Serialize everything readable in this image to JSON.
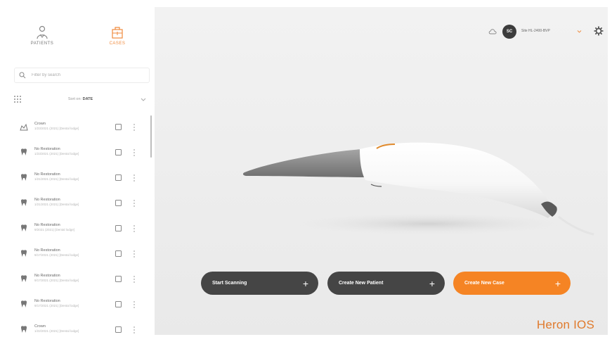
{
  "sidebar": {
    "tabs": [
      {
        "label": "PATIENTS",
        "icon": "patient-icon"
      },
      {
        "label": "CASES",
        "icon": "cases-icon",
        "active": true
      }
    ],
    "search_placeholder": "Filter by search",
    "sort_prefix": "Sort on:",
    "sort_value": "DATE",
    "cases": [
      {
        "title": "Crown",
        "subtitle": "1/23/2021 (2021) [Dental lodge]",
        "icon": "crown-icon"
      },
      {
        "title": "No Restoration",
        "subtitle": "1/23/2021 (2021) [Dental lodge]",
        "icon": "tooth-icon"
      },
      {
        "title": "No Restoration",
        "subtitle": "1/21/2021 (2021) [Dental lodge]",
        "icon": "tooth-icon"
      },
      {
        "title": "No Restoration",
        "subtitle": "1/21/2021 (2021) [Dental lodge]",
        "icon": "tooth-icon"
      },
      {
        "title": "No Restoration",
        "subtitle": "9/2021 (2021) [Dental lodge]",
        "icon": "tooth-icon"
      },
      {
        "title": "No Restoration",
        "subtitle": "9/17/2021 (2021) [Dental lodge]",
        "icon": "tooth-icon"
      },
      {
        "title": "No Restoration",
        "subtitle": "9/17/2021 (2021) [Dental lodge]",
        "icon": "tooth-icon"
      },
      {
        "title": "No Restoration",
        "subtitle": "9/17/2021 (2021) [Dental lodge]",
        "icon": "tooth-icon"
      },
      {
        "title": "Crown",
        "subtitle": "1/22/2021 (2021) [Dental lodge]",
        "icon": "tooth-icon"
      }
    ]
  },
  "topbar": {
    "avatar_initials": "SC",
    "user_label": "Site HL-2400-BVP",
    "cloud_icon": "cloud-icon",
    "settings_icon": "gear-icon"
  },
  "actions": {
    "start_scanning": "Start Scanning",
    "create_patient": "Create New Patient",
    "create_case": "Create New Case"
  },
  "brand": "Heron IOS",
  "colors": {
    "accent": "#f58424",
    "dark_button": "#454545",
    "brand": "#e07a2c"
  }
}
